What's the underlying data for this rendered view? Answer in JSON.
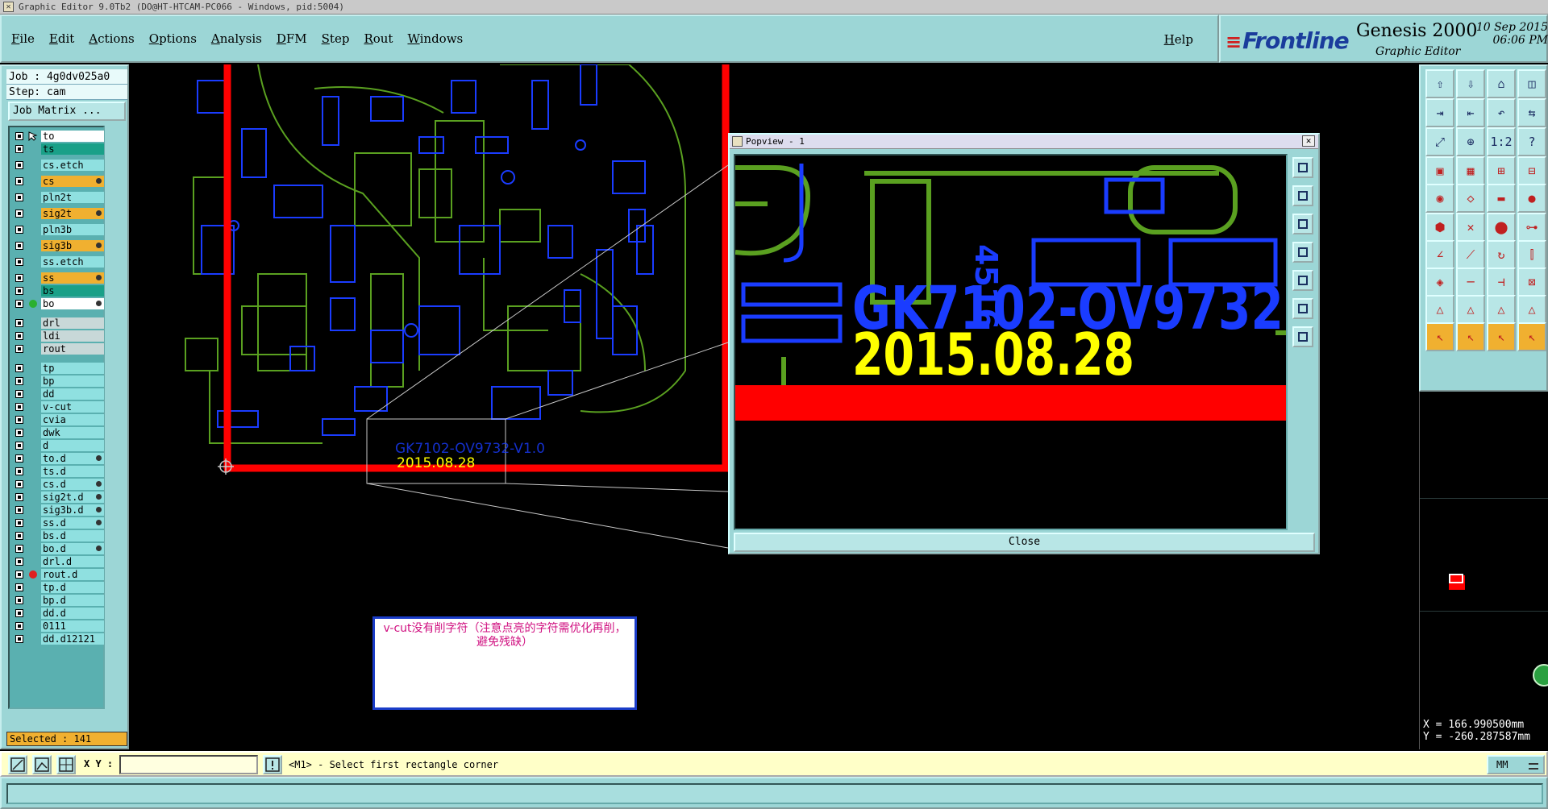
{
  "window_title": "Graphic Editor 9.0Tb2 (DO@HT-HTCAM-PC066 - Windows, pid:5004)",
  "menu": [
    "File",
    "Edit",
    "Actions",
    "Options",
    "Analysis",
    "DFM",
    "Step",
    "Rout",
    "Windows"
  ],
  "help_label": "Help",
  "brand": {
    "logo": "Frontline",
    "product": "Genesis 2000",
    "subtitle": "Graphic Editor",
    "date": "10 Sep 2015",
    "time": "06:06 PM"
  },
  "job": {
    "job_line": "Job : 4g0dv025a0",
    "step_line": "Step: cam",
    "matrix_button": "Job Matrix ..."
  },
  "layers": [
    {
      "name": "to",
      "style": "w",
      "icon": "cursor"
    },
    {
      "name": "ts",
      "style": "g"
    },
    {
      "name": "cs.etch",
      "style": "c"
    },
    {
      "name": "cs",
      "style": "o",
      "dot": true
    },
    {
      "name": "pln2t",
      "style": "c"
    },
    {
      "name": "sig2t",
      "style": "o",
      "dot": true
    },
    {
      "name": "pln3b",
      "style": "c"
    },
    {
      "name": "sig3b",
      "style": "o",
      "dot": true
    },
    {
      "name": "ss.etch",
      "style": "c"
    },
    {
      "name": "ss",
      "style": "o",
      "dot": true
    },
    {
      "name": "bs",
      "style": "g"
    },
    {
      "name": "bo",
      "style": "w",
      "icon": "green-dot",
      "dot": true
    },
    {
      "name": "drl",
      "style": "l"
    },
    {
      "name": "ldi",
      "style": "l"
    },
    {
      "name": "rout",
      "style": "l"
    },
    {
      "name": "tp",
      "style": "c"
    },
    {
      "name": "bp",
      "style": "c"
    },
    {
      "name": "dd",
      "style": "c"
    },
    {
      "name": "v-cut",
      "style": "c"
    },
    {
      "name": "cvia",
      "style": "c"
    },
    {
      "name": "dwk",
      "style": "c"
    },
    {
      "name": "d",
      "style": "c"
    },
    {
      "name": "to.d",
      "style": "c",
      "dot": true
    },
    {
      "name": "ts.d",
      "style": "c"
    },
    {
      "name": "cs.d",
      "style": "c",
      "dot": true
    },
    {
      "name": "sig2t.d",
      "style": "c",
      "dot": true
    },
    {
      "name": "sig3b.d",
      "style": "c",
      "dot": true
    },
    {
      "name": "ss.d",
      "style": "c",
      "dot": true
    },
    {
      "name": "bs.d",
      "style": "c"
    },
    {
      "name": "bo.d",
      "style": "c",
      "dot": true
    },
    {
      "name": "drl.d",
      "style": "c"
    },
    {
      "name": "rout.d",
      "style": "c",
      "icon": "red-dot"
    },
    {
      "name": "tp.d",
      "style": "c"
    },
    {
      "name": "bp.d",
      "style": "c"
    },
    {
      "name": "dd.d",
      "style": "c"
    },
    {
      "name": "0111",
      "style": "c"
    },
    {
      "name": "dd.d12121",
      "style": "c"
    }
  ],
  "selected": "Selected : 141",
  "note_text": "v-cut没有削字符（注意点亮的字符需优化再削，避免残缺）",
  "board_text": {
    "part": "GK7102-OV9732-V1.0",
    "date": "2015.08.28"
  },
  "popview": {
    "title": "Popview - 1",
    "close_label": "Close",
    "big_part": "GK7102-OV9732",
    "big_date": "2015.08.28",
    "vertical_text": "4516"
  },
  "coords": {
    "x": "X = 166.990500mm",
    "y": "Y = -260.287587mm"
  },
  "bottom": {
    "xy_label": "X Y :",
    "input_value": "",
    "prompt": "<M1> - Select first rectangle corner",
    "unit": "MM"
  },
  "colors": {
    "panel": "#9cd6d6",
    "board_edge": "#ff0000",
    "silk": "#ffff00",
    "copper_blue": "#1a3cff",
    "copper_green": "#5aa020"
  }
}
